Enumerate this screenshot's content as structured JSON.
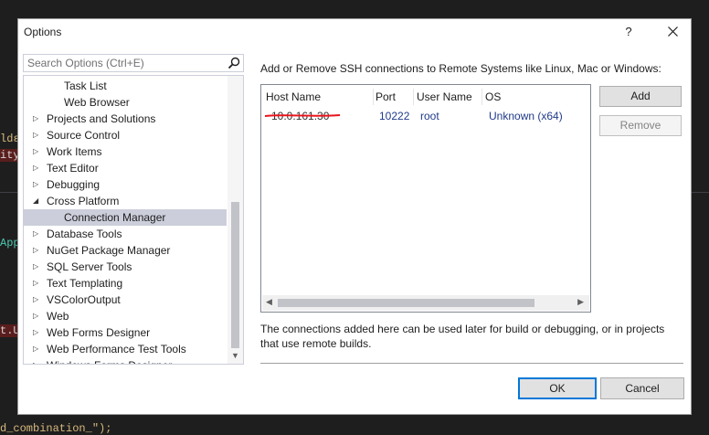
{
  "background_code": [
    {
      "text": ",",
      "color": "#d4d4d4"
    },
    {
      "text": "ldε",
      "color": "#d7ba7d"
    },
    {
      "text": "ity",
      "color": "#d4d4d4"
    },
    {
      "text": "App",
      "color": "#4ec9b0"
    },
    {
      "text": "t.U",
      "color": "#d4d4d4"
    },
    {
      "text": "d_combination_\");",
      "color": "#d7ba7d"
    }
  ],
  "dialog": {
    "title": "Options",
    "help_label": "?"
  },
  "search": {
    "placeholder": "Search Options (Ctrl+E)"
  },
  "tree": {
    "items": [
      {
        "label": "Task List",
        "level": 2,
        "expanded": null
      },
      {
        "label": "Web Browser",
        "level": 2,
        "expanded": null
      },
      {
        "label": "Projects and Solutions",
        "level": 1,
        "expanded": false
      },
      {
        "label": "Source Control",
        "level": 1,
        "expanded": false
      },
      {
        "label": "Work Items",
        "level": 1,
        "expanded": false
      },
      {
        "label": "Text Editor",
        "level": 1,
        "expanded": false
      },
      {
        "label": "Debugging",
        "level": 1,
        "expanded": false
      },
      {
        "label": "Cross Platform",
        "level": 1,
        "expanded": true
      },
      {
        "label": "Connection Manager",
        "level": 2,
        "expanded": null,
        "selected": true
      },
      {
        "label": "Database Tools",
        "level": 1,
        "expanded": false
      },
      {
        "label": "NuGet Package Manager",
        "level": 1,
        "expanded": false
      },
      {
        "label": "SQL Server Tools",
        "level": 1,
        "expanded": false
      },
      {
        "label": "Text Templating",
        "level": 1,
        "expanded": false
      },
      {
        "label": "VSColorOutput",
        "level": 1,
        "expanded": false
      },
      {
        "label": "Web",
        "level": 1,
        "expanded": false
      },
      {
        "label": "Web Forms Designer",
        "level": 1,
        "expanded": false
      },
      {
        "label": "Web Performance Test Tools",
        "level": 1,
        "expanded": false
      },
      {
        "label": "Windows Forms Designer",
        "level": 1,
        "expanded": false
      }
    ]
  },
  "panel": {
    "description": "Add or Remove SSH connections to Remote Systems like Linux, Mac or Windows:",
    "columns": [
      "Host Name",
      "Port",
      "User Name",
      "OS"
    ],
    "rows": [
      {
        "host": "10.0.161.30",
        "port": "10222",
        "user": "root",
        "os": "Unknown (x64)"
      }
    ],
    "add_label": "Add",
    "remove_label": "Remove",
    "note": "The connections added here can be used later for build or debugging, or in projects that use remote builds."
  },
  "footer": {
    "ok_label": "OK",
    "cancel_label": "Cancel"
  },
  "colors": {
    "accent": "#0078d7",
    "selection": "#cccedb",
    "redaction": "#e8141c"
  }
}
